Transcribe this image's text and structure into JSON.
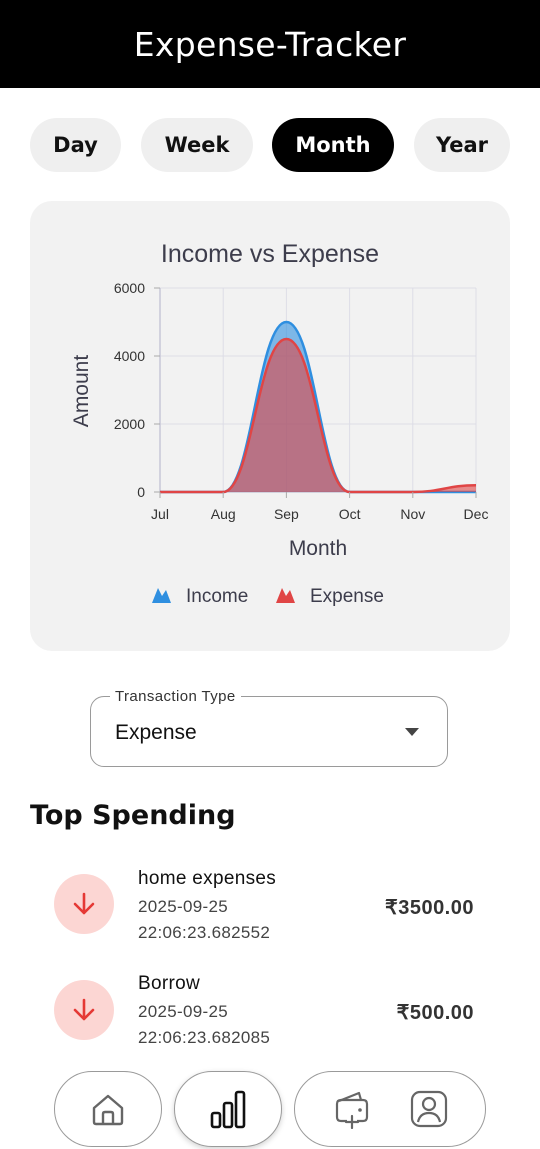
{
  "app": {
    "title": "Expense-Tracker"
  },
  "period_tabs": [
    {
      "label": "Day",
      "active": false
    },
    {
      "label": "Week",
      "active": false
    },
    {
      "label": "Month",
      "active": true
    },
    {
      "label": "Year",
      "active": false
    }
  ],
  "chart_data": {
    "type": "area",
    "title": "Income vs Expense",
    "xlabel": "Month",
    "ylabel": "Amount",
    "categories": [
      "Jul",
      "Aug",
      "Sep",
      "Oct",
      "Nov",
      "Dec"
    ],
    "yticks": [
      "0",
      "2000",
      "4000",
      "6000"
    ],
    "ylim": [
      0,
      6000
    ],
    "grid": true,
    "legend_position": "bottom",
    "series": [
      {
        "name": "Income",
        "values": [
          0,
          0,
          5000,
          0,
          0,
          0
        ],
        "color": "#2f8fe0"
      },
      {
        "name": "Expense",
        "values": [
          0,
          0,
          4500,
          0,
          0,
          200
        ],
        "color": "#e04545"
      }
    ]
  },
  "filter": {
    "label": "Transaction Type",
    "value": "Expense"
  },
  "top_spending": {
    "title": "Top Spending",
    "items": [
      {
        "name": "home expenses",
        "date": "2025-09-25",
        "time": "22:06:23.682552",
        "amount": "₹3500.00",
        "icon": "arrow-down-icon"
      },
      {
        "name": "Borrow",
        "date": "2025-09-25",
        "time": "22:06:23.682085",
        "amount": "₹500.00",
        "icon": "arrow-down-icon"
      }
    ]
  },
  "bottom_nav": {
    "items": [
      {
        "icon": "home-icon",
        "active": false
      },
      {
        "icon": "bar-chart-icon",
        "active": true
      },
      {
        "icon": "wallet-add-icon",
        "active": false
      },
      {
        "icon": "profile-icon",
        "active": false
      }
    ]
  },
  "colors": {
    "income": "#2f8fe0",
    "expense": "#e04545",
    "accent": "#000000"
  }
}
